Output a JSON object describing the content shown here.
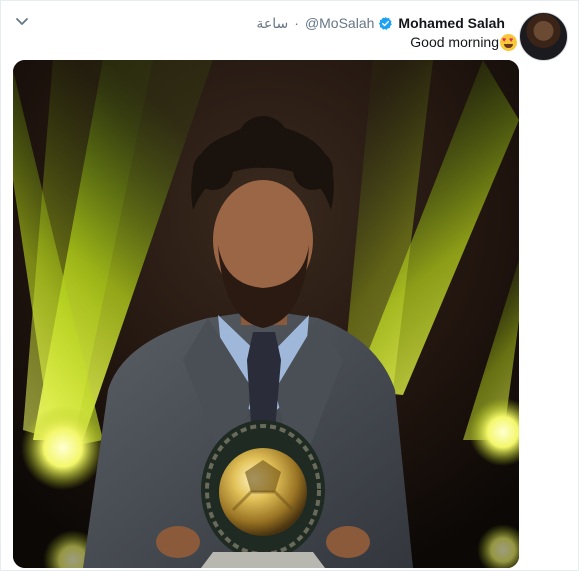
{
  "tweet": {
    "author_name": "Mohamed Salah",
    "handle": "@MoSalah",
    "separator": "·",
    "timestamp": "ساعة",
    "text": "Good morning",
    "emoji": "heart-eyes-emoji",
    "verified": true,
    "media_alt": "Mohamed Salah holding the African Player of the Year trophy on stage"
  },
  "icons": {
    "menu": "chevron-down-icon",
    "verified": "verified-badge-icon"
  },
  "colors": {
    "accent": "#1da1f2",
    "text": "#14171a",
    "muted": "#657786",
    "border": "#e6ecf0"
  }
}
